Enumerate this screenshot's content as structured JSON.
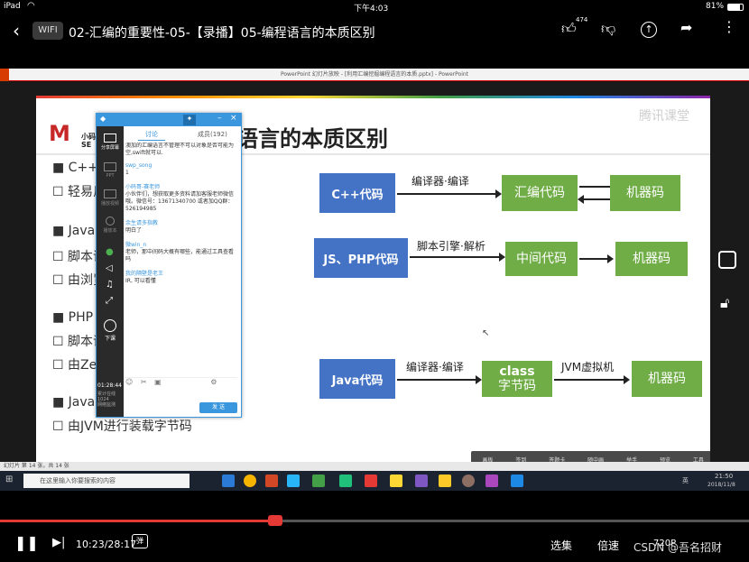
{
  "status_bar": {
    "device": "iPad",
    "time": "下午4:03",
    "battery": "81%"
  },
  "header": {
    "network_badge": "WIFI",
    "title": "02-汇编的重要性-05-【录播】05-编程语言的本质区别",
    "like_count": "474"
  },
  "ppt": {
    "window_title": "PowerPoint 幻灯片放映 - [利用汇编挖掘编程语言的本质.pptx] - PowerPoint",
    "slide_status": "幻灯片 第 14 张，共 14 张"
  },
  "slide": {
    "title": "程语言的本质区别",
    "logo_text": "小码",
    "logo_sub": "SE",
    "watermark": "腾讯课堂",
    "bullets": [
      "■ C++",
      "☐ 轻易反",
      "■ JavaS",
      "☐ 脚本语",
      "☐ 由浏览",
      "■ PHP",
      "☐ 脚本语",
      "☐ 由Zen",
      "■ Java",
      "☐ 由JVM进行装载字节码"
    ],
    "row1": {
      "source": "C++代码",
      "step": "编译器·编译",
      "mid": "汇编代码",
      "target": "机器码"
    },
    "row2": {
      "source": "JS、PHP代码",
      "step": "脚本引擎·解析",
      "mid": "中间代码",
      "target": "机器码"
    },
    "row3": {
      "source": "Java代码",
      "step": "编译器·编译",
      "mid_line1": "class",
      "mid_line2": "字节码",
      "step2": "JVM虚拟机",
      "target": "机器码"
    },
    "toolbar": [
      "画板",
      "签到",
      "答题卡",
      "随中画",
      "举手",
      "预览",
      "工具"
    ]
  },
  "chat": {
    "tabs": [
      "讨论",
      "成员(192)"
    ],
    "side_labels": [
      "分享屏幕",
      "PPT",
      "播放视频",
      "播放本",
      "下课"
    ],
    "timer": "01:28:44",
    "timer_sub": "累计在线\n1024\n网络监测",
    "messages": [
      {
        "name": "",
        "text": "澳加的汇编语言不管理不可以对象是否可能为空,swift就可以."
      },
      {
        "name": "swp_song",
        "text": "1"
      },
      {
        "name": "小码哥-赛老师",
        "text": "小伙伴们，想获取更多资料请加客服老师微信哦。微信号：13671340700 或者加QQ群：526194985"
      },
      {
        "name": "余生请多指教",
        "text": "明白了"
      },
      {
        "name": "微win_n",
        "text": "老师，那中间码大概有哪些，能通过工具查看吗"
      },
      {
        "name": "我的隔壁是老王",
        "text": "IR, 可以看懂"
      }
    ],
    "send_label": "发 送"
  },
  "taskbar": {
    "search_placeholder": "在这里输入你要搜索的内容",
    "clock_time": "21:50",
    "clock_date": "2018/11/8",
    "ime": "英"
  },
  "player": {
    "time": "10:23/28:17",
    "select_label": "选集",
    "speed_label": "倍速",
    "quality_label": "720P",
    "watermark": "CSDN @吾名招财",
    "progress": 0.368
  }
}
